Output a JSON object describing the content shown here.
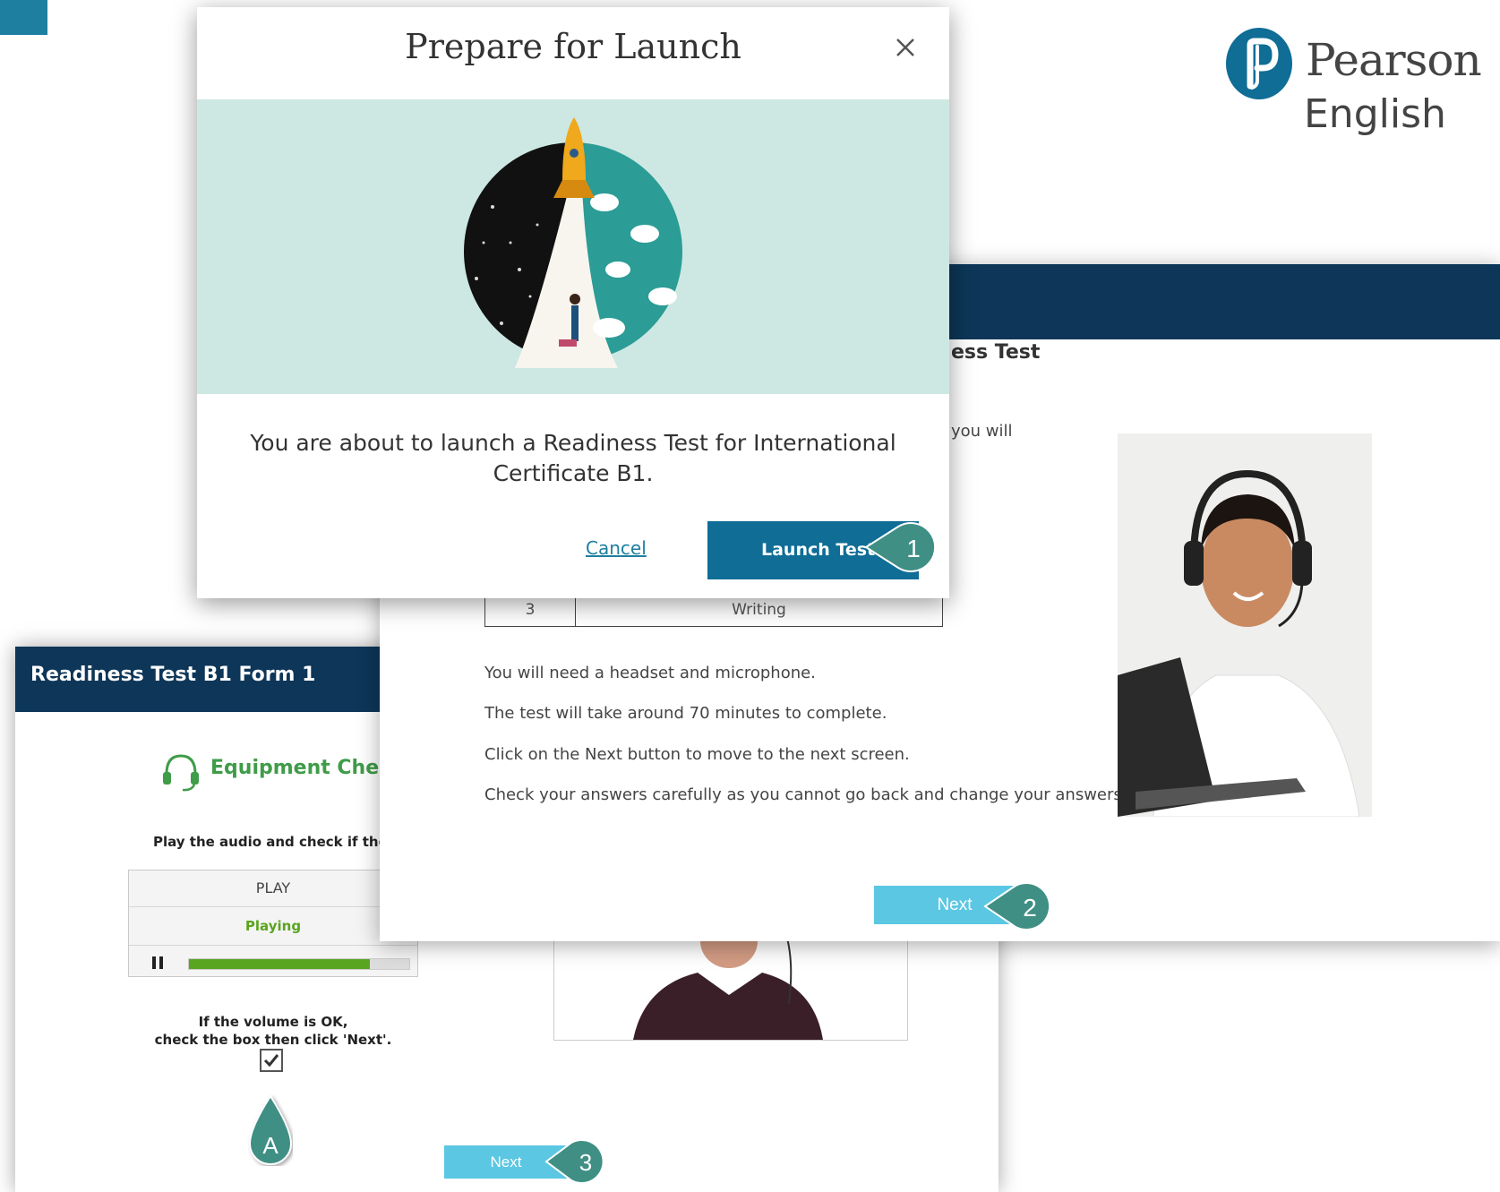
{
  "logo": {
    "word1": "Pearson",
    "word2": "English"
  },
  "equipment_panel": {
    "title": "Readiness Test B1 Form 1",
    "section_title": "Equipment Check",
    "instruction": "Play the audio and check if the v",
    "player": {
      "play_label": "PLAY",
      "status": "Playing",
      "progress": 0.82
    },
    "volume_text_line1": "If the volume is OK,",
    "volume_text_line2": "check the box then click 'Next'.",
    "checkbox_checked": true,
    "next_label": "Next"
  },
  "intro_panel": {
    "heading_partial": "ess Test",
    "partial_text": "you will",
    "table_row": {
      "number": "3",
      "skill": "Writing"
    },
    "lines": [
      "You will need a headset and microphone.",
      "The test will take around 70 minutes to complete.",
      "Click on the Next button to move to the next screen.",
      "Check your answers carefully as you cannot go back and change your answers."
    ],
    "next_label": "Next"
  },
  "modal": {
    "title": "Prepare for Launch",
    "message": "You are about to launch a Readiness Test for International Certificate B1.",
    "cancel_label": "Cancel",
    "launch_label": "Launch Test"
  },
  "callouts": {
    "one": "1",
    "two": "2",
    "three": "3",
    "a": "A"
  },
  "colors": {
    "navy": "#0d3658",
    "teal": "#1e7fa0",
    "launch": "#0f6d96",
    "next": "#5bc7e3",
    "callout": "#3f8f84",
    "green": "#3f9c48"
  }
}
